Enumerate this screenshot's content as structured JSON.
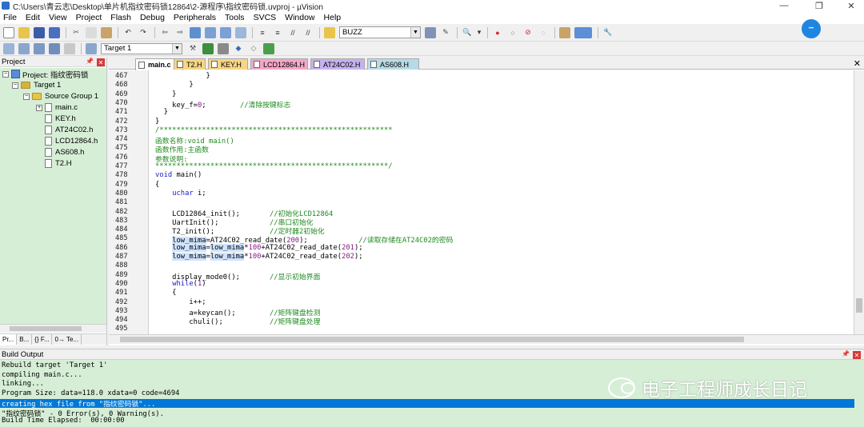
{
  "window": {
    "title": "C:\\Users\\青云志\\Desktop\\单片机指纹密码锁12864\\2-源程序\\指纹密码锁.uvproj - µVision",
    "controls": [
      "—",
      "❐",
      "✕"
    ]
  },
  "menu": [
    "File",
    "Edit",
    "View",
    "Project",
    "Flash",
    "Debug",
    "Peripherals",
    "Tools",
    "SVCS",
    "Window",
    "Help"
  ],
  "toolbar": {
    "find_combo_value": "BUZZ",
    "target_combo_value": "Target 1"
  },
  "project": {
    "pane_title": "Project",
    "root": "Project: 指纹密码锁",
    "target": "Target 1",
    "group": "Source Group 1",
    "files": [
      "main.c",
      "KEY.h",
      "AT24C02.h",
      "LCD12864.h",
      "AS608.h",
      "T2.H"
    ],
    "bottom_tabs": [
      "Pr...",
      "B...",
      "{} F...",
      "0→ Te..."
    ]
  },
  "editor": {
    "tabs": [
      {
        "label": "main.c",
        "color": "#ffffff"
      },
      {
        "label": "T2.H",
        "color": "#f6d586"
      },
      {
        "label": "KEY.H",
        "color": "#f6d586"
      },
      {
        "label": "LCD12864.H",
        "color": "#f3a7c9"
      },
      {
        "label": "AT24C02.H",
        "color": "#c6b2ee"
      },
      {
        "label": "AS608.H",
        "color": "#b7dbe6"
      }
    ],
    "lines": [
      {
        "n": "467",
        "t": "            }"
      },
      {
        "n": "468",
        "t": "        }"
      },
      {
        "n": "469",
        "t": "    }"
      },
      {
        "n": "470",
        "t": "    key_f=0;        //清除按键标志"
      },
      {
        "n": "471",
        "t": "  }"
      },
      {
        "n": "472",
        "t": "}"
      },
      {
        "n": "473",
        "t": "/*******************************************************"
      },
      {
        "n": "474",
        "t": "函数名称:void main()"
      },
      {
        "n": "475",
        "t": "函数作用:主函数"
      },
      {
        "n": "476",
        "t": "参数说明:"
      },
      {
        "n": "477",
        "t": "*******************************************************/"
      },
      {
        "n": "478",
        "t": "void main()"
      },
      {
        "n": "479",
        "t": "{"
      },
      {
        "n": "480",
        "t": "    uchar i;"
      },
      {
        "n": "481",
        "t": ""
      },
      {
        "n": "482",
        "t": "    LCD12864_init();       //初始化LCD12864"
      },
      {
        "n": "483",
        "t": "    UartInit();            //串口初始化"
      },
      {
        "n": "484",
        "t": "    T2_init();             //定时器2初始化"
      },
      {
        "n": "485",
        "t": "    low_mima=AT24C02_read_date(200);            //读取存储在AT24C02的密码"
      },
      {
        "n": "486",
        "t": "    low_mima=low_mima*100+AT24C02_read_date(201);"
      },
      {
        "n": "487",
        "t": "    low_mima=low_mima*100+AT24C02_read_date(202);"
      },
      {
        "n": "488",
        "t": ""
      },
      {
        "n": "489",
        "t": "    display_mode0();       //显示初始界面"
      },
      {
        "n": "490",
        "t": "    while(1)"
      },
      {
        "n": "491",
        "t": "    {"
      },
      {
        "n": "492",
        "t": "        i++;"
      },
      {
        "n": "493",
        "t": "        a=keycan();        //矩阵键盘检测"
      },
      {
        "n": "494",
        "t": "        chuli();           //矩阵键盘处理"
      },
      {
        "n": "495",
        "t": ""
      }
    ]
  },
  "build": {
    "title": "Build Output",
    "lines": [
      "Rebuild target 'Target 1'",
      "compiling main.c...",
      "linking...",
      "Program Size: data=118.0 xdata=0 code=4694",
      "creating hex file from \"指纹密码锁\"...",
      "\"指纹密码锁\" - 0 Error(s), 0 Warning(s).",
      "Build Time Elapsed:  00:00:00"
    ],
    "selected_index": 4
  },
  "watermark": "电子工程师成长日记"
}
